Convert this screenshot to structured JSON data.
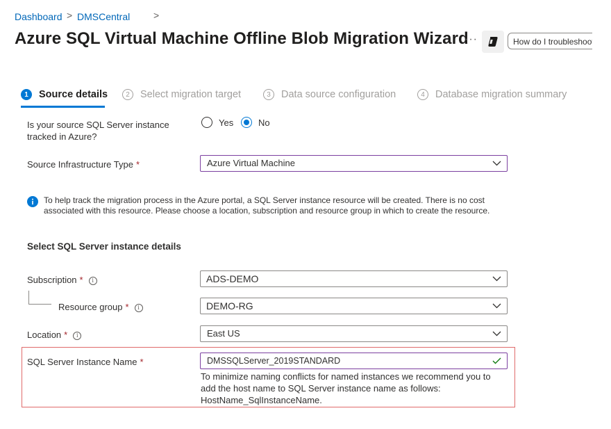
{
  "breadcrumb": {
    "items": [
      "Dashboard",
      "DMSCentral"
    ],
    "separator": ">"
  },
  "title": "Azure SQL Virtual Machine Offline Blob Migration Wizard",
  "header": {
    "more_label": "···",
    "troubleshoot_label": "How do I troubleshoot"
  },
  "steps": [
    {
      "number": "1",
      "label": "Source details",
      "state": "active"
    },
    {
      "number": "2",
      "label": "Select migration target",
      "state": "inactive"
    },
    {
      "number": "3",
      "label": "Data source configuration",
      "state": "inactive"
    },
    {
      "number": "4",
      "label": "Database migration summary",
      "state": "inactive"
    }
  ],
  "form": {
    "tracked_question_line1": "Is your source SQL Server instance",
    "tracked_question_line2": "tracked in Azure?",
    "tracked_options": {
      "yes": "Yes",
      "no": "No",
      "selected": "No"
    },
    "infra_label": "Source Infrastructure Type",
    "infra_value": "Azure Virtual Machine",
    "required_mark": "*",
    "info_message": "To help track the migration process in the Azure portal, a SQL Server instance resource will be created. There is no cost associated with this resource. Please choose a location, subscription and resource group in which to create the resource.",
    "section_heading": "Select SQL Server instance details",
    "subscription_label": "Subscription",
    "subscription_value": "ADS-DEMO",
    "resource_group_label": "Resource group",
    "resource_group_value": "DEMO-RG",
    "location_label": "Location",
    "location_value": "East US",
    "instance_name_label": "SQL Server Instance Name",
    "instance_name_value": "DMSSQLServer_2019STANDARD",
    "instance_help_line1": "To minimize naming conflicts for named instances we recommend you to",
    "instance_help_line2": "add the host name to SQL Server instance name as follows:",
    "instance_help_line3": "HostName_SqlInstanceName."
  },
  "icons": {
    "info": "info-icon",
    "chevron": "chevron-down-icon",
    "check": "checkmark-icon",
    "copilot": "copilot-icon"
  },
  "colors": {
    "accent": "#0078d4",
    "link": "#0067b8",
    "required": "#a4262c",
    "highlight": "#e06a6a",
    "valid": "#107c10",
    "focus_border": "#7b3fa0"
  }
}
